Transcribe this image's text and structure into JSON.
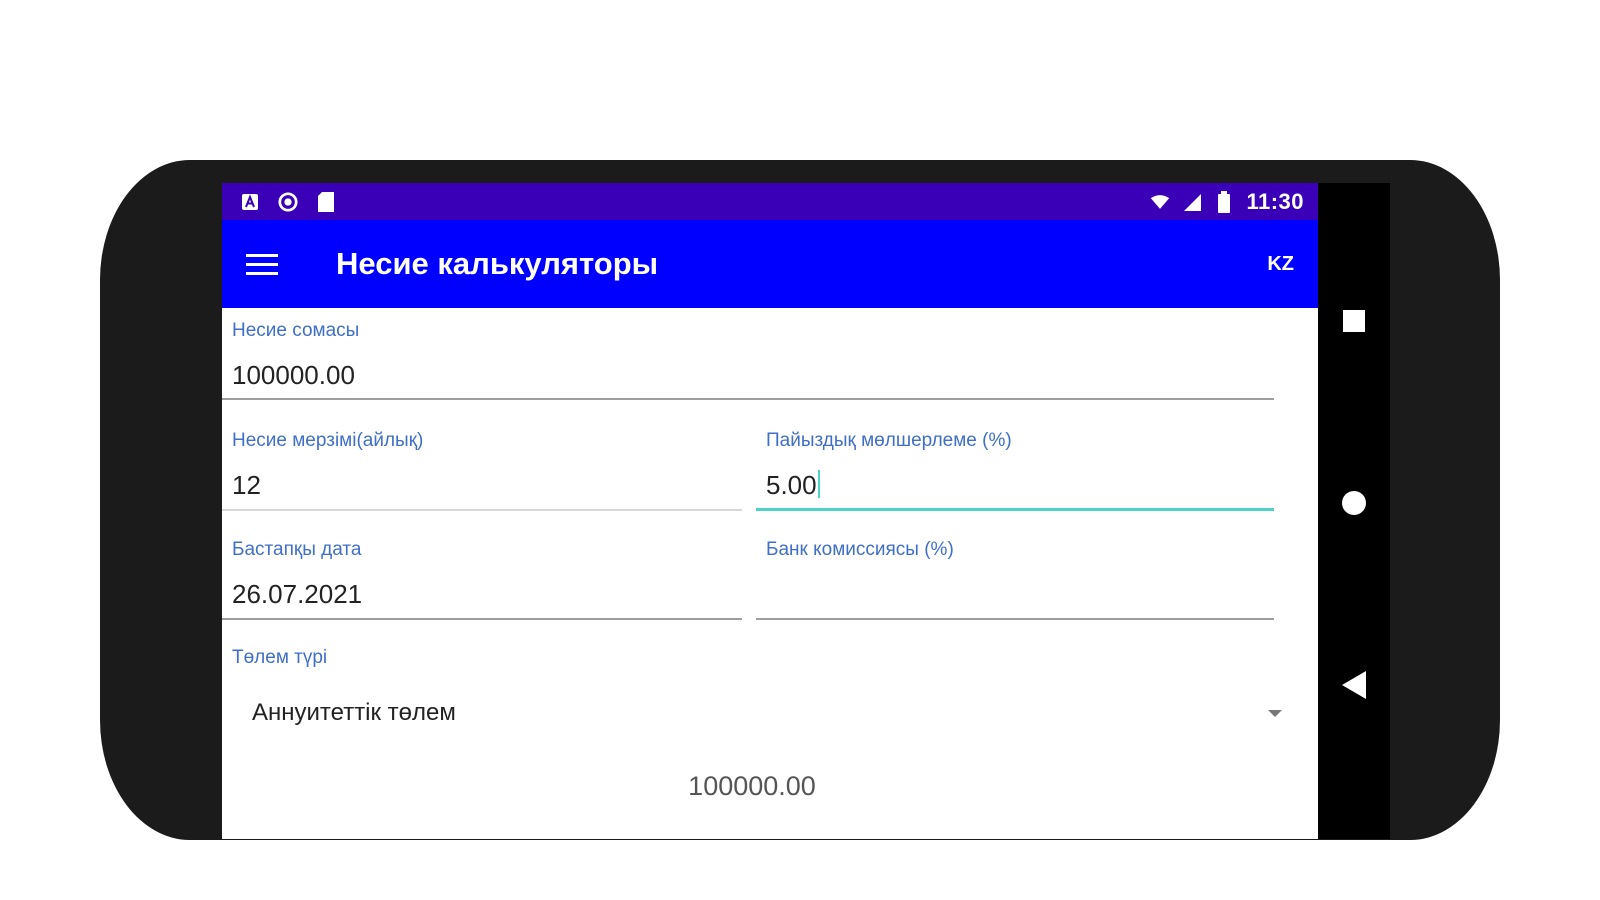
{
  "status_bar": {
    "time": "11:30",
    "left_icons": [
      "a-notification-icon",
      "circle-notification-icon",
      "sd-card-icon"
    ],
    "right_icons": [
      "wifi-icon",
      "signal-icon",
      "battery-icon"
    ]
  },
  "app_bar": {
    "title": "Несие калькуляторы",
    "language": "KZ",
    "menu_icon": "hamburger-menu-icon"
  },
  "form": {
    "loan_amount": {
      "label": "Несие сомасы",
      "value": "100000.00"
    },
    "loan_term": {
      "label": "Несие мерзімі(айлық)",
      "value": "12"
    },
    "interest_rate": {
      "label": "Пайыздық мөлшерлеме (%)",
      "value": "5.00"
    },
    "start_date": {
      "label": "Бастапқы дата",
      "value": "26.07.2021"
    },
    "bank_commission": {
      "label": "Банк комиссиясы (%)",
      "value": ""
    },
    "payment_type": {
      "label": "Төлем түрі",
      "value": "Аннуитеттік төлем"
    }
  },
  "result": {
    "value": "100000.00"
  },
  "nav_bar": {
    "icons": [
      "recents-square-icon",
      "home-circle-icon",
      "back-triangle-icon"
    ]
  },
  "colors": {
    "status_bar": "#3a00b8",
    "app_bar": "#0000ff",
    "label": "#3f6fc6",
    "accent": "#4fd3c4"
  }
}
